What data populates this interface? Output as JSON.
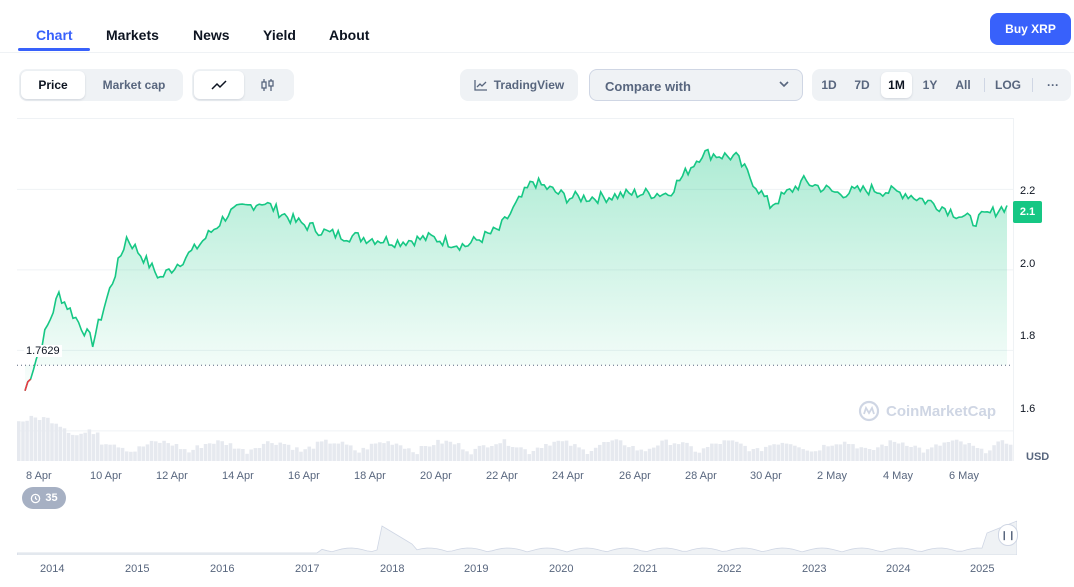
{
  "nav": {
    "tabs": [
      "Chart",
      "Markets",
      "News",
      "Yield",
      "About"
    ],
    "active_tab": "Chart",
    "buy_label": "Buy XRP"
  },
  "toolbar": {
    "price_label": "Price",
    "market_cap_label": "Market cap",
    "tradingview_label": "TradingView",
    "compare_placeholder": "Compare with",
    "ranges": [
      "1D",
      "7D",
      "1M",
      "1Y",
      "All"
    ],
    "active_range": "1M",
    "log_label": "LOG",
    "more_label": "···"
  },
  "chart": {
    "current_price_label": "2.1",
    "open_price_label": "1.7629",
    "currency": "USD",
    "watermark": "CoinMarketCap",
    "y_ticks": [
      "2.2",
      "2.0",
      "1.8",
      "1.6"
    ],
    "x_ticks": [
      "8 Apr",
      "10 Apr",
      "12 Apr",
      "14 Apr",
      "16 Apr",
      "18 Apr",
      "20 Apr",
      "22 Apr",
      "24 Apr",
      "26 Apr",
      "28 Apr",
      "30 Apr",
      "2 May",
      "4 May",
      "6 May"
    ],
    "events_count": "35",
    "colors": {
      "up": "#16c784",
      "down": "#ea3943",
      "accent": "#3861fb"
    }
  },
  "navigator": {
    "years": [
      "2014",
      "2015",
      "2016",
      "2017",
      "2018",
      "2019",
      "2020",
      "2021",
      "2022",
      "2023",
      "2024",
      "2025"
    ]
  },
  "chart_data": {
    "type": "area",
    "x": [
      "8 Apr",
      "9 Apr",
      "10 Apr",
      "11 Apr",
      "12 Apr",
      "13 Apr",
      "14 Apr",
      "15 Apr",
      "16 Apr",
      "17 Apr",
      "18 Apr",
      "19 Apr",
      "20 Apr",
      "21 Apr",
      "22 Apr",
      "23 Apr",
      "24 Apr",
      "25 Apr",
      "26 Apr",
      "27 Apr",
      "28 Apr",
      "29 Apr",
      "30 Apr",
      "1 May",
      "2 May",
      "3 May",
      "4 May",
      "5 May",
      "6 May",
      "7 May"
    ],
    "series": [
      {
        "values": [
          1.7,
          1.94,
          1.82,
          2.08,
          1.98,
          2.05,
          2.14,
          2.17,
          2.12,
          2.09,
          2.08,
          2.07,
          2.08,
          2.06,
          2.1,
          2.22,
          2.18,
          2.18,
          2.19,
          2.19,
          2.29,
          2.28,
          2.16,
          2.22,
          2.19,
          2.2,
          2.19,
          2.16,
          2.12,
          2.16
        ]
      }
    ],
    "ylim": [
      1.55,
      2.35
    ],
    "y_ticks": [
      1.6,
      1.8,
      2.0,
      2.2
    ],
    "reference_line": 1.7629,
    "last_value": 2.1,
    "currency": "USD"
  }
}
